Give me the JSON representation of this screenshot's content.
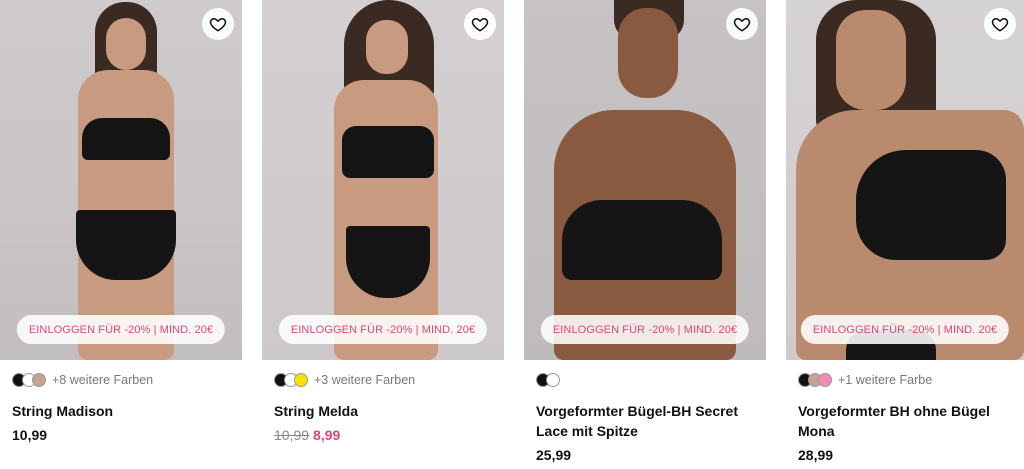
{
  "products": [
    {
      "name": "String Madison",
      "price": "10,99",
      "promo": "EINLOGGEN FÜR -20% | MIND. 20€",
      "more_colors": "+8 weitere Farben",
      "swatches": [
        "#111111",
        "#ffffff",
        "#c4a48f"
      ]
    },
    {
      "name": "String Melda",
      "old_price": "10,99",
      "sale_price": "8,99",
      "promo": "EINLOGGEN FÜR -20% | MIND. 20€",
      "more_colors": "+3 weitere Farben",
      "swatches": [
        "#111111",
        "#ffffff",
        "#f5e400"
      ]
    },
    {
      "name": "Vorgeformter Bügel-BH Secret Lace mit Spitze",
      "price": "25,99",
      "promo": "EINLOGGEN FÜR -20% | MIND. 20€",
      "more_colors": "",
      "swatches": [
        "#111111",
        "#ffffff"
      ]
    },
    {
      "name": "Vorgeformter BH ohne Bügel Mona",
      "price": "28,99",
      "promo": "EINLOGGEN FÜR -20% | MIND. 20€",
      "more_colors": "+1 weitere Farbe",
      "swatches": [
        "#111111",
        "#c4a48f",
        "#f08bb4"
      ]
    }
  ],
  "icons": {
    "wishlist": "heart-icon"
  },
  "colors": {
    "accent": "#e0457b"
  }
}
